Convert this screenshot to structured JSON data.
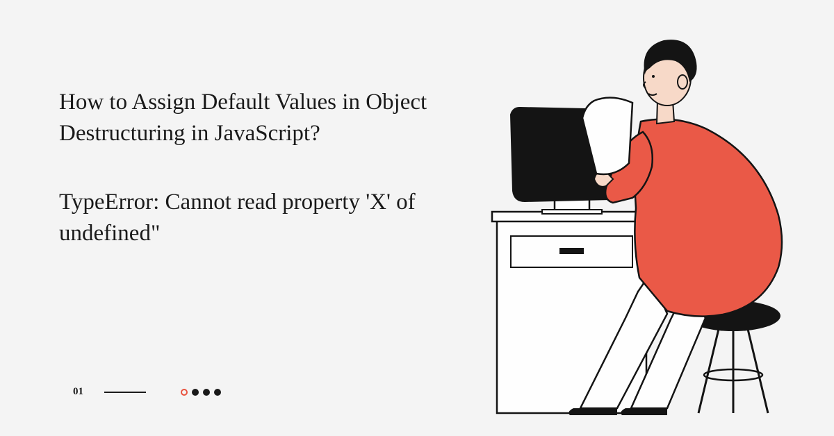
{
  "title": "How to Assign Default Values in Object Destructuring in JavaScript?",
  "subtitle": "TypeError: Cannot read property 'X' of undefined\"",
  "page_number": "01",
  "colors": {
    "accent": "#e8533f",
    "dark": "#141414",
    "bg": "#f4f4f4"
  }
}
